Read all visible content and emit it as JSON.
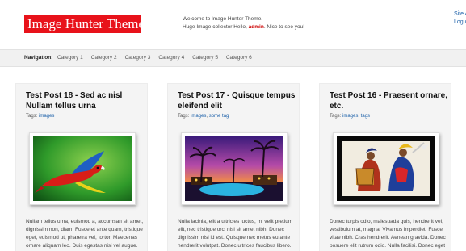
{
  "header": {
    "logo_text": "Image Hunter Theme",
    "welcome_line1": "Welcome to Image Hunter Theme.",
    "welcome_line2_prefix": "Huge Image collector Hello, ",
    "welcome_user": "admin",
    "welcome_line2_suffix": ". Nice to see you!",
    "top_link_1": "Site A",
    "top_link_2": "Log o"
  },
  "nav": {
    "label": "Navigation:",
    "items": [
      "Category 1",
      "Category 2",
      "Category 3",
      "Category 4",
      "Category 5",
      "Category 6"
    ]
  },
  "posts": [
    {
      "title": "Test Post 18 - Sed ac nisl Nullam tellus urna",
      "tags_label": "Tags:",
      "tags": [
        "images"
      ],
      "excerpt": "Nullam tellus urna, euismod a, accumsan sit amet, dignissim non, diam. Fusce et ante quam, tristique eget, euismod ut, pharetra vel, tortor. Maecenas ornare aliquam leo. Duis egestas nisi vel augue. Morbi"
    },
    {
      "title": "Test Post 17 - Quisque tempus eleifend elit",
      "tags_label": "Tags:",
      "tags": [
        "images",
        "some tag"
      ],
      "excerpt": "Nulla lacinia, elit a ultricies luctus, mi velit pretium elit, nec tristique orci nisi sit amet nibh. Donec dignissim nisl id est. Quisque nec metus eu ante hendrerit volutpat. Donec ultrices faucibus libero. Curabitur ultrices"
    },
    {
      "title": "Test Post 16 - Praesent ornare, etc.",
      "tags_label": "Tags:",
      "tags": [
        "images",
        "tags"
      ],
      "excerpt": "Donec turpis odio, malesuada quis, hendrerit vel, vestibulum at, magna. Vivamus imperdiet. Fusce vitae nibh. Cras hendrerit. Aenean gravida. Donec posuere elit rutrum odio. Nulla facilisi. Donec eget est in"
    }
  ],
  "colors": {
    "brand_red": "#e8121a",
    "link_blue": "#1a5fa8",
    "nav_bg": "#f1f1f1",
    "card_bg": "#f4f4f4"
  }
}
